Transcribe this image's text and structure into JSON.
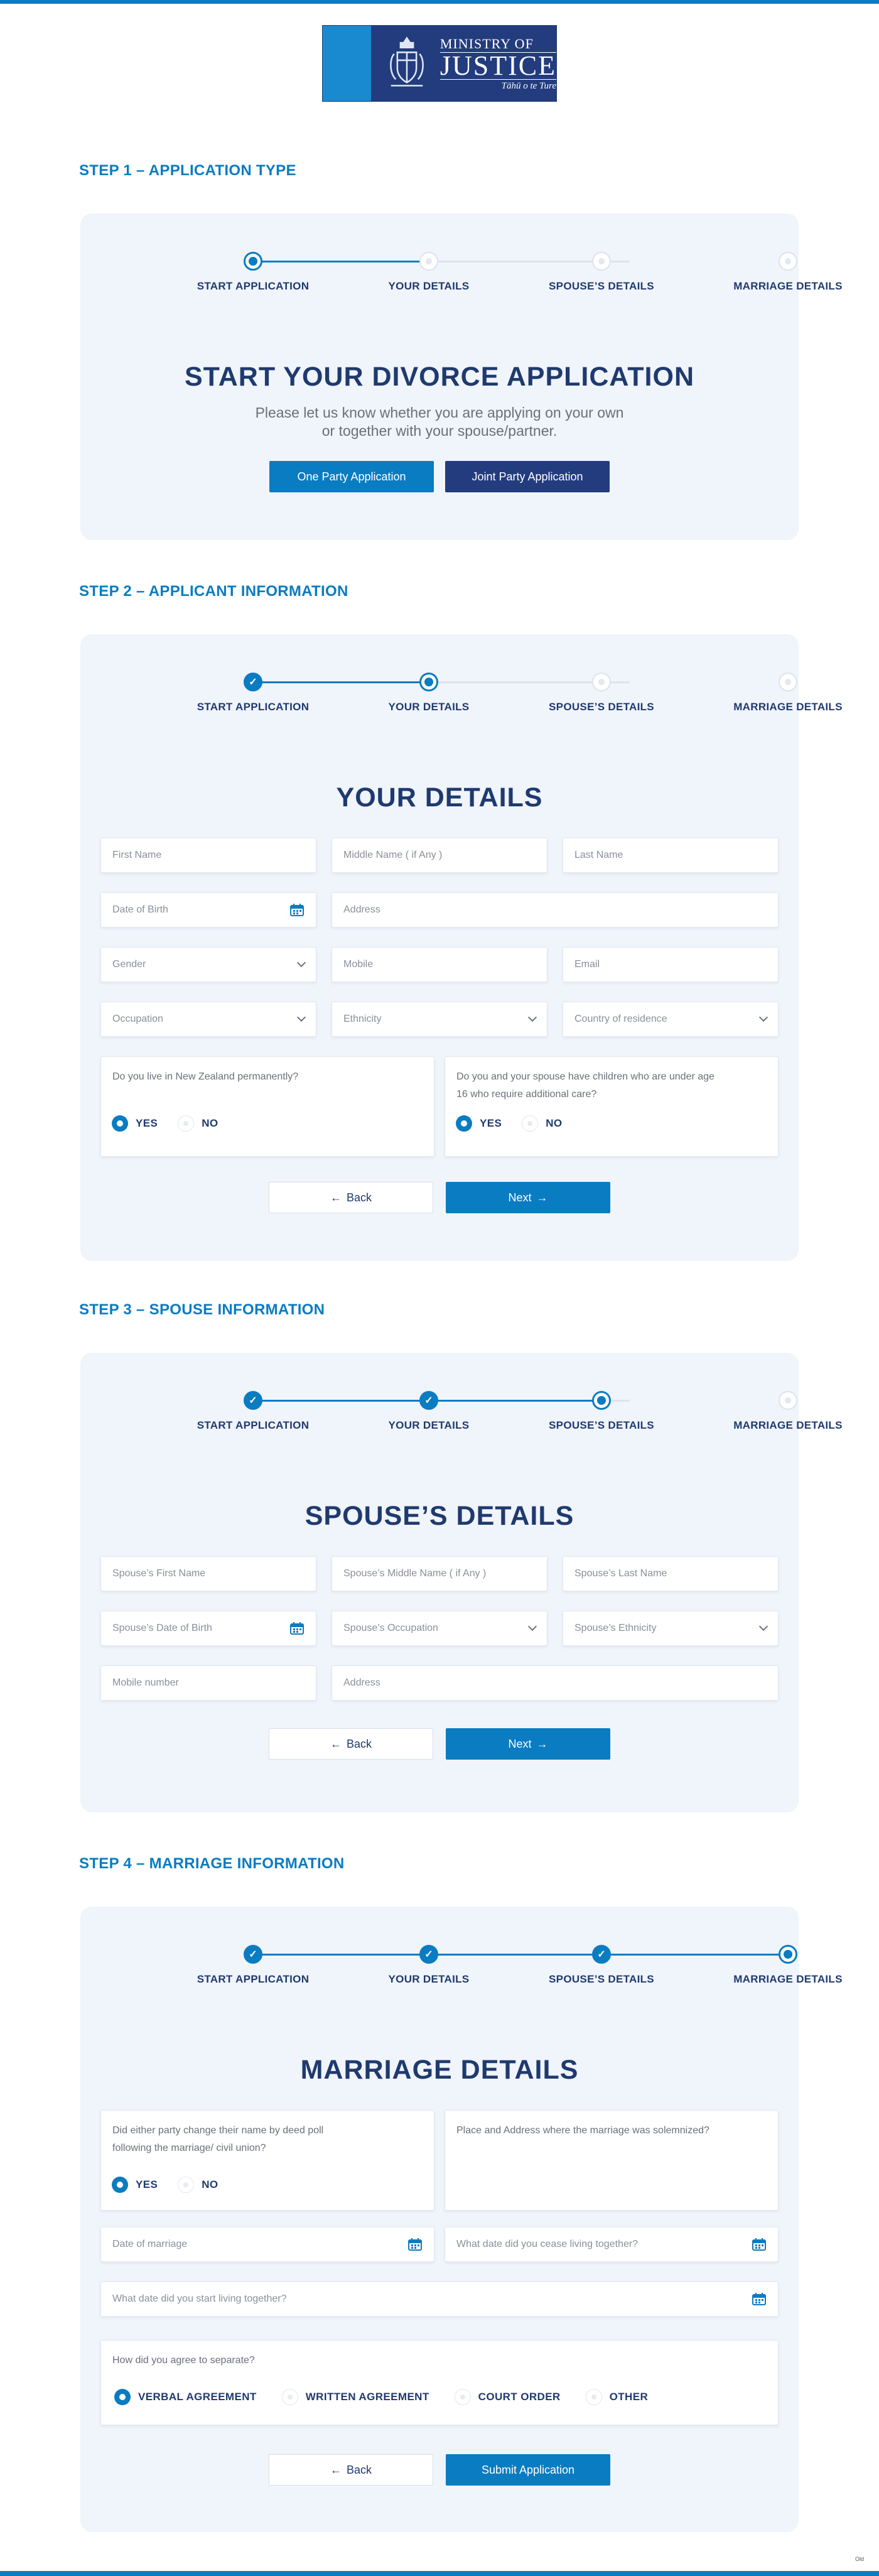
{
  "logo": {
    "line1": "MINISTRY OF",
    "line2": "JUSTICE",
    "line3": "Tāhū o te Ture"
  },
  "progress_steps": [
    "START APPLICATION",
    "YOUR DETAILS",
    "SPOUSE’S DETAILS",
    "MARRIAGE DETAILS"
  ],
  "step1": {
    "title": "STEP 1 – APPLICATION TYPE",
    "heading": "START YOUR DIVORCE APPLICATION",
    "sub_line1": "Please let us know whether you are applying on your own",
    "sub_line2": "or together with your spouse/partner.",
    "one_party": "One Party Application",
    "joint_party": "Joint Party Application",
    "current_step": 1
  },
  "step2": {
    "title": "STEP 2 – APPLICANT INFORMATION",
    "heading": "YOUR DETAILS",
    "current_step": 2,
    "fields": {
      "first_name": "First Name",
      "middle_name": "Middle Name ( if Any )",
      "last_name": "Last Name",
      "dob": "Date of Birth",
      "address": "Address",
      "gender": "Gender",
      "mobile": "Mobile",
      "email": "Email",
      "occupation": "Occupation",
      "ethnicity": "Ethnicity",
      "country": "Country of residence"
    },
    "q1": "Do you live in New Zealand permanently?",
    "q2_line1": "Do you and your spouse have children who are under age",
    "q2_line2": "16 who require additional care?",
    "yes": "YES",
    "no": "NO",
    "back": "Back",
    "next": "Next"
  },
  "step3": {
    "title": "STEP 3 – SPOUSE INFORMATION",
    "heading": "SPOUSE’S DETAILS",
    "current_step": 3,
    "fields": {
      "first_name": "Spouse’s First Name",
      "middle_name": "Spouse’s Middle Name ( if Any )",
      "last_name": "Spouse’s Last Name",
      "dob": "Spouse’s Date of Birth",
      "occupation": "Spouse’s Occupation",
      "ethnicity": "Spouse’s Ethnicity",
      "mobile": "Mobile number",
      "address": "Address"
    },
    "back": "Back",
    "next": "Next"
  },
  "step4": {
    "title": "STEP 4 – MARRIAGE INFORMATION",
    "heading": "MARRIAGE DETAILS",
    "current_step": 4,
    "q_deed_line1": "Did either party change their name by deed poll",
    "q_deed_line2": "following the marriage/ civil union?",
    "place_address": "Place and Address where the marriage was solemnized?",
    "date_marriage": "Date of marriage",
    "cease_date": "What date did you cease living together?",
    "start_date": "What date did you start living together?",
    "q_separate": "How did you agree to separate?",
    "options": [
      "VERBAL AGREEMENT",
      "WRITTEN AGREEMENT",
      "COURT ORDER",
      "OTHER"
    ],
    "selected_option": "VERBAL AGREEMENT",
    "yes": "YES",
    "no": "NO",
    "back": "Back",
    "submit": "Submit Application"
  },
  "corner_text": "Old",
  "colors": {
    "primary": "#0a7cc1",
    "navy": "#1f3a6e",
    "card_bg": "#f0f4fb"
  }
}
